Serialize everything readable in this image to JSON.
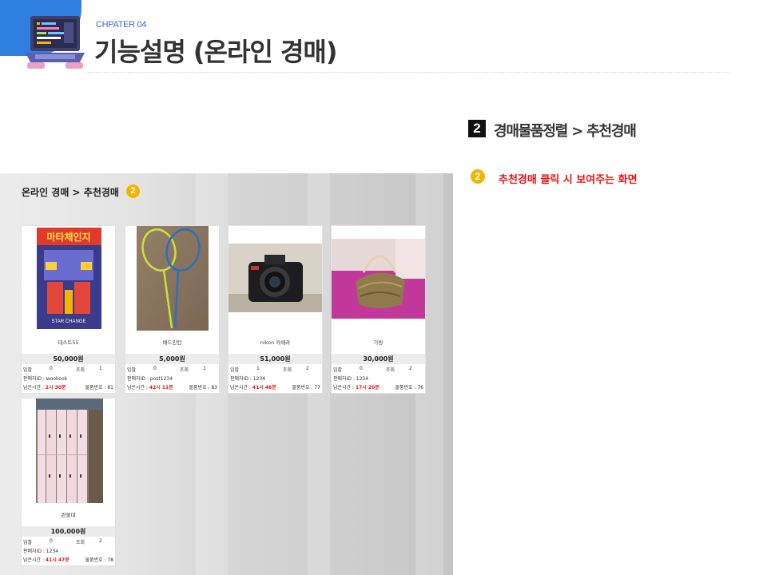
{
  "header": {
    "chapter": "CHPATER 04",
    "title": "기능설명 (온라인 경매)"
  },
  "right_panel": {
    "section_number": "2",
    "section_title": "경매물품정렬 > 추천경매",
    "note_number": "2",
    "note_text": "추천경매 클릭 시 보여주는 화면"
  },
  "screenshot": {
    "breadcrumb": "온라인 경매 > 추천경매",
    "badge": "2",
    "labels": {
      "bids": "입찰",
      "views": "조회",
      "seller_prefix": "판매자ID : ",
      "time_prefix": "남은시간 : ",
      "item_prefix": "물품번호 : "
    },
    "items": [
      {
        "name": "테스트55",
        "price": "50,000원",
        "bids": "0",
        "views": "1",
        "seller": "wookook",
        "remaining": "2시 30분",
        "item_no": "81"
      },
      {
        "name": "배드민턴",
        "price": "5,000원",
        "bids": "0",
        "views": "1",
        "seller": "post1234",
        "remaining": "42시 11분",
        "item_no": "83"
      },
      {
        "name": "nikon 카메라",
        "price": "51,000원",
        "bids": "1",
        "views": "2",
        "seller": "1234",
        "remaining": "41시 46분",
        "item_no": "77"
      },
      {
        "name": "가방",
        "price": "30,000원",
        "bids": "0",
        "views": "2",
        "seller": "1234",
        "remaining": "17시 20분",
        "item_no": "76"
      },
      {
        "name": "관물대",
        "price": "100,000원",
        "bids": "0",
        "views": "2",
        "seller": "1234",
        "remaining": "41시 47분",
        "item_no": "78"
      }
    ],
    "box_art_text": [
      "마타체인지",
      "STAR CHANGE"
    ]
  },
  "colors": {
    "accent_blue": "#2f7fe0",
    "badge_yellow": "#f4b400",
    "alert_red": "#e11111"
  }
}
